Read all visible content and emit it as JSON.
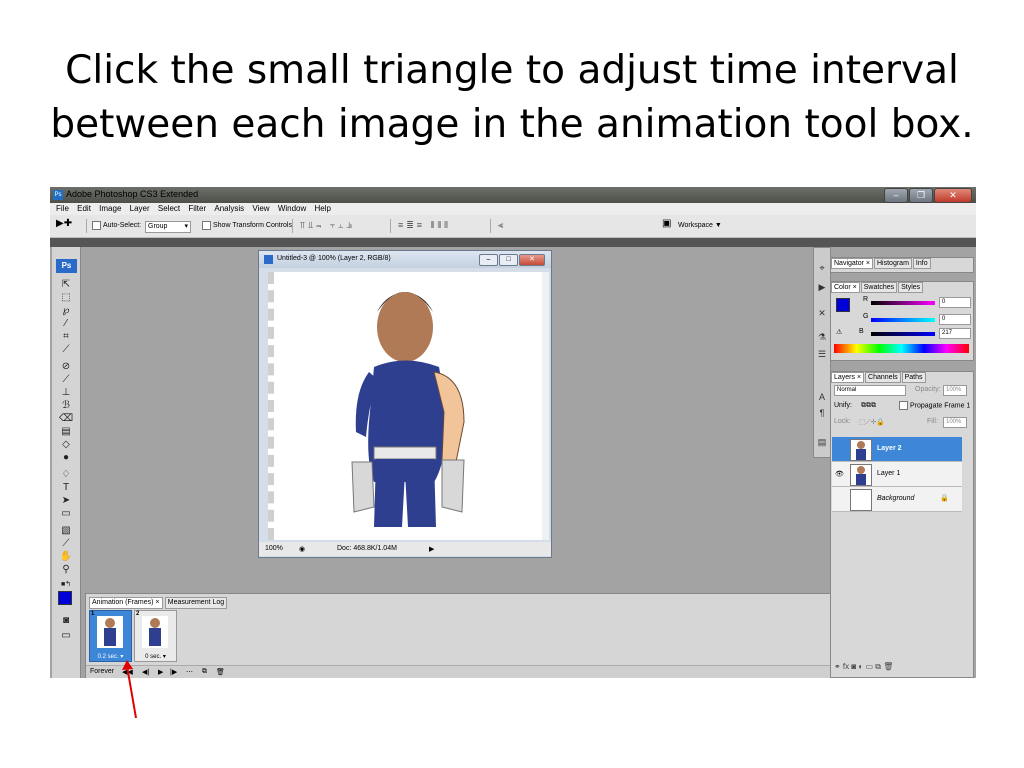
{
  "slide": {
    "title_line1": "Click the small triangle to adjust time interval",
    "title_line2": "between each image in the animation tool box."
  },
  "app": {
    "icon_text": "Ps",
    "title": "Adobe Photoshop CS3 Extended"
  },
  "menu": [
    "File",
    "Edit",
    "Image",
    "Layer",
    "Select",
    "Filter",
    "Analysis",
    "View",
    "Window",
    "Help"
  ],
  "options": {
    "auto_select_label": "Auto-Select:",
    "auto_select_value": "Group",
    "show_transform_label": "Show Transform Controls",
    "workspace_label": "Workspace ▼"
  },
  "toolbox": {
    "logo": "Ps"
  },
  "document": {
    "title": "Untitled-3 @ 100% (Layer 2, RGB/8)",
    "zoom": "100%",
    "doc_info": "Doc: 468.8K/1.04M"
  },
  "animation": {
    "tabs": [
      "Animation (Frames) ×",
      "Measurement Log"
    ],
    "frames": [
      {
        "number": "1",
        "delay": "0.2 sec."
      },
      {
        "number": "2",
        "delay": "0 sec."
      }
    ],
    "loop": "Forever"
  },
  "navigator": {
    "tabs": [
      "Navigator ×",
      "Histogram",
      "Info"
    ]
  },
  "color": {
    "tabs": [
      "Color ×",
      "Swatches",
      "Styles"
    ],
    "channels": [
      {
        "name": "R",
        "value": "0",
        "color": "#e22020"
      },
      {
        "name": "G",
        "value": "0",
        "color": "#22a02a"
      },
      {
        "name": "B",
        "value": "217",
        "color": "#1a23d6"
      }
    ],
    "foreground": "#0000d9"
  },
  "layers": {
    "tabs": [
      "Layers ×",
      "Channels",
      "Paths"
    ],
    "blend_mode": "Normal",
    "opacity_label": "Opacity:",
    "opacity_value": "100%",
    "unify_label": "Unify:",
    "propagate_label": "Propagate Frame 1",
    "lock_label": "Lock:",
    "fill_label": "Fill:",
    "fill_value": "100%",
    "items": [
      "Layer 2",
      "Layer 1",
      "Background"
    ]
  },
  "colors": {
    "accent": "#3d86d8",
    "annotation_arrow": "#e00000"
  }
}
